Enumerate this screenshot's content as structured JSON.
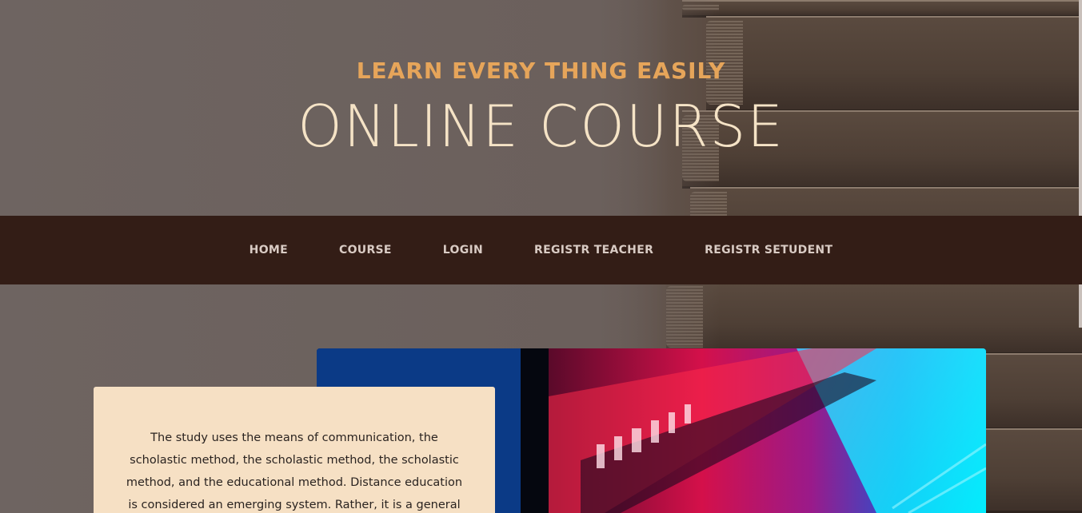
{
  "hero": {
    "subtitle": "LEARN EVERY THING EASILY",
    "title": "ONLINE COURSE"
  },
  "nav": {
    "items": [
      {
        "label": "HOME"
      },
      {
        "label": "COURSE"
      },
      {
        "label": "LOGIN"
      },
      {
        "label": "REGISTR TEACHER"
      },
      {
        "label": "REGISTR SETUDENT"
      }
    ]
  },
  "intro": {
    "text": "The study uses the means of communication, the scholastic method, the scholastic method, the scholastic method, and the educational method. Distance education is considered an emerging system. Rather, it is a general"
  },
  "colors": {
    "accent": "#e6a55a",
    "title": "#f5e3c6",
    "navbar": "#331d16",
    "card": "#f6e0c4"
  },
  "images": {
    "background": "stack-of-books-photo",
    "feature": "laptop-screen-neon-photo"
  }
}
